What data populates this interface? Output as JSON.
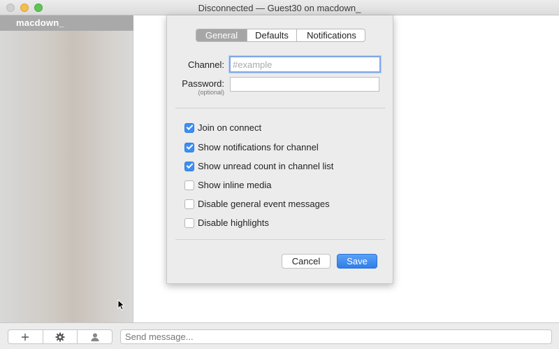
{
  "window": {
    "title": "Disconnected — Guest30 on macdown_"
  },
  "sidebar": {
    "server_name": "macdown_"
  },
  "sheet": {
    "tabs": [
      {
        "label": "General",
        "active": true
      },
      {
        "label": "Defaults",
        "active": false
      },
      {
        "label": "Notifications",
        "active": false
      }
    ],
    "channel": {
      "label": "Channel:",
      "value": "",
      "placeholder": "#example"
    },
    "password": {
      "label": "Password:",
      "sublabel": "(optional)",
      "value": ""
    },
    "options": [
      {
        "label": "Join on connect",
        "checked": true
      },
      {
        "label": "Show notifications for channel",
        "checked": true
      },
      {
        "label": "Show unread count in channel list",
        "checked": true
      },
      {
        "label": "Show inline media",
        "checked": false
      },
      {
        "label": "Disable general event messages",
        "checked": false
      },
      {
        "label": "Disable highlights",
        "checked": false
      }
    ],
    "buttons": {
      "cancel": "Cancel",
      "save": "Save"
    }
  },
  "bottombar": {
    "message_placeholder": "Send message...",
    "icons": [
      "plus-icon",
      "gear-icon",
      "user-icon"
    ]
  },
  "colors": {
    "accent": "#3d8ef3",
    "save_button": "#2f7de9",
    "focus_ring": "#7fa8e5",
    "sidebar_selection": "#a9a9a9"
  }
}
